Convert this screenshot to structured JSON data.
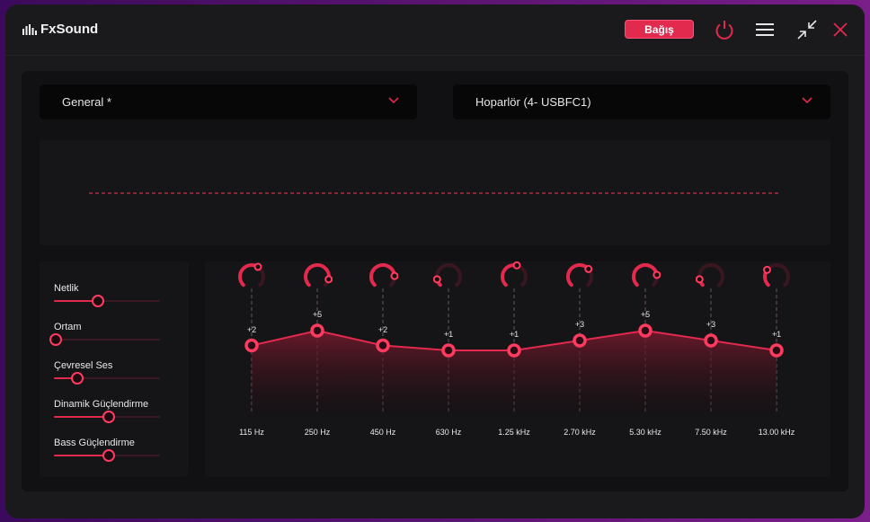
{
  "app": {
    "title": "FxSound"
  },
  "header": {
    "donate_label": "Bağış"
  },
  "icons": {
    "power": "power-icon",
    "menu": "hamburger-menu-icon",
    "shrink": "shrink-icon",
    "close": "close-icon"
  },
  "colors": {
    "accent": "#e2294e",
    "bg": "#1a1a1c",
    "panel": "#111113"
  },
  "presets": {
    "selected": "General *"
  },
  "output": {
    "selected": "Hoparlör (4- USBFC1)"
  },
  "effects": [
    {
      "label": "Netlik",
      "value": 0.4
    },
    {
      "label": "Ortam",
      "value": 0.0
    },
    {
      "label": "Çevresel Ses",
      "value": 0.2
    },
    {
      "label": "Dinamik Güçlendirme",
      "value": 0.5
    },
    {
      "label": "Bass Güçlendirme",
      "value": 0.5
    }
  ],
  "eq": {
    "bands": [
      {
        "freq": "115 Hz",
        "gain_label": "+2",
        "gain": 2,
        "knob": 0.62
      },
      {
        "freq": "250 Hz",
        "gain_label": "+5",
        "gain": 5,
        "knob": 0.88
      },
      {
        "freq": "450 Hz",
        "gain_label": "+2",
        "gain": 2,
        "knob": 0.82
      },
      {
        "freq": "630 Hz",
        "gain_label": "+1",
        "gain": 1,
        "knob": 0.12
      },
      {
        "freq": "1.25 kHz",
        "gain_label": "+1",
        "gain": 1,
        "knob": 0.55
      },
      {
        "freq": "2.70 kHz",
        "gain_label": "+3",
        "gain": 3,
        "knob": 0.68
      },
      {
        "freq": "5.30 kHz",
        "gain_label": "+5",
        "gain": 5,
        "knob": 0.8
      },
      {
        "freq": "7.50 kHz",
        "gain_label": "+3",
        "gain": 3,
        "knob": 0.12
      },
      {
        "freq": "13.00 kHz",
        "gain_label": "+1",
        "gain": 1,
        "knob": 0.3
      }
    ]
  }
}
